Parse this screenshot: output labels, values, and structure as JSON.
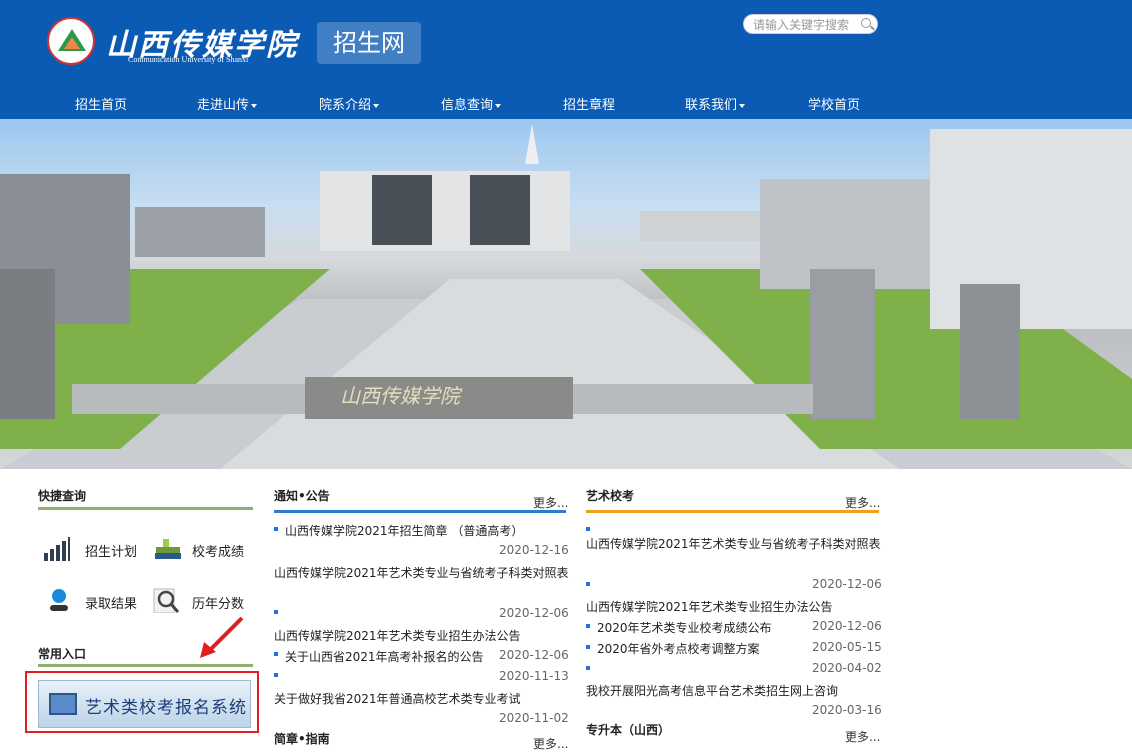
{
  "header": {
    "school_name": "山西传媒学院",
    "school_name_en": "Communication University of Shanxi",
    "site_title": "招生网",
    "search_placeholder": "请输入关键字搜索"
  },
  "nav": [
    {
      "label": "招生首页",
      "has_dropdown": false
    },
    {
      "label": "走进山传",
      "has_dropdown": true
    },
    {
      "label": "院系介绍",
      "has_dropdown": true
    },
    {
      "label": "信息查询",
      "has_dropdown": true
    },
    {
      "label": "招生章程",
      "has_dropdown": false
    },
    {
      "label": "联系我们",
      "has_dropdown": true
    },
    {
      "label": "学校首页",
      "has_dropdown": false
    }
  ],
  "banner": {
    "gate_sign": "山西传媒学院"
  },
  "quick": {
    "title": "快捷查询",
    "items": [
      {
        "label": "招生计划",
        "icon": "bar-chart-icon"
      },
      {
        "label": "校考成绩",
        "icon": "books-icon"
      },
      {
        "label": "录取结果",
        "icon": "user-icon"
      },
      {
        "label": "历年分数",
        "icon": "magnifier-icon"
      }
    ],
    "common_title": "常用入口",
    "art_system_label": "艺术类校考报名系统"
  },
  "notice": {
    "title": "通知•公告",
    "more": "更多...",
    "items": [
      {
        "title": "山西传媒学院2021年招生简章 （普通高考）",
        "date": "2020-12-16"
      },
      {
        "title": "山西传媒学院2021年艺术类专业与省统考子科类对照表",
        "date": "2020-12-06"
      },
      {
        "title": "山西传媒学院2021年艺术类专业招生办法公告",
        "date": ""
      },
      {
        "title": "关于山西省2021年高考补报名的公告",
        "date": "2020-12-06"
      },
      {
        "title": "",
        "date": "2020-11-13"
      },
      {
        "title": "关于做好我省2021年普通高校艺术类专业考试",
        "date": "2020-11-02"
      }
    ],
    "next_title": "简章•指南",
    "next_more": "更多..."
  },
  "art": {
    "title": "艺术校考",
    "more": "更多...",
    "items": [
      {
        "title": "山西传媒学院2021年艺术类专业与省统考子科类对照表",
        "date": "2020-12-06"
      },
      {
        "title": "山西传媒学院2021年艺术类专业招生办法公告",
        "date": "2020-12-06"
      },
      {
        "title": "2020年省外考点校考调整方案",
        "date": "2020-05-15"
      },
      {
        "title": "2020年省外考点校考调整方案",
        "date": "2020-04-02"
      },
      {
        "title": "我校开展阳光高考信息平台艺术类招生网上咨询",
        "date": "2020-03-16"
      }
    ],
    "item3_title": "2020年艺术类专业校考成绩公布",
    "next_title": "专升本（山西）",
    "next_more": "更多..."
  },
  "colors": {
    "brand_blue": "#0b5bb4",
    "notice_underline": "#2d7bd0",
    "art_underline": "#f0a020",
    "quick_underline": "#8fb070",
    "highlight_red": "#e02020"
  }
}
